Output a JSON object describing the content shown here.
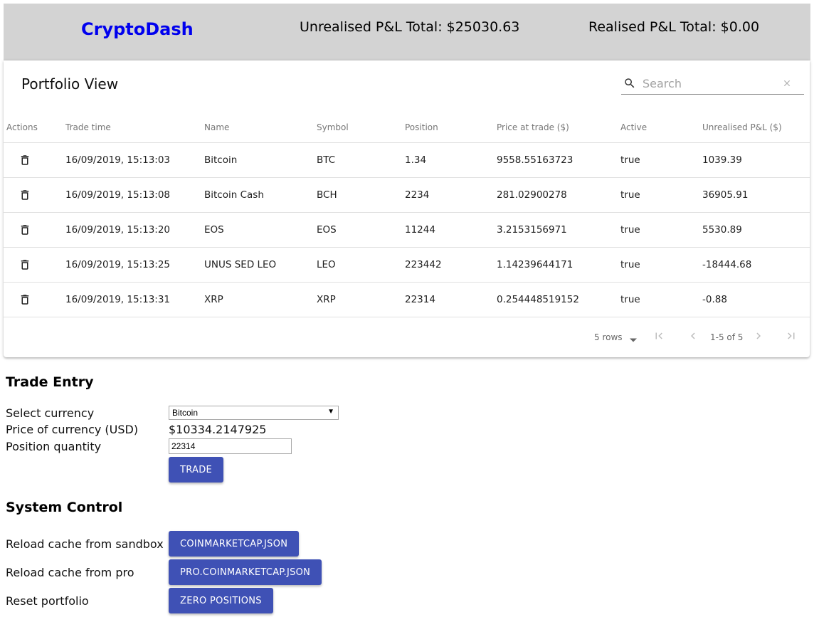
{
  "header": {
    "brand": "CryptoDash",
    "unrealised_total": "Unrealised P&L Total: $25030.63",
    "realised_total": "Realised P&L Total: $0.00"
  },
  "portfolio": {
    "title": "Portfolio View",
    "search_placeholder": "Search",
    "columns": [
      "Actions",
      "Trade time",
      "Name",
      "Symbol",
      "Position",
      "Price at trade ($)",
      "Active",
      "Unrealised P&L ($)"
    ],
    "rows": [
      {
        "time": "16/09/2019, 15:13:03",
        "name": "Bitcoin",
        "symbol": "BTC",
        "position": "1.34",
        "price": "9558.55163723",
        "active": "true",
        "pnl": "1039.39"
      },
      {
        "time": "16/09/2019, 15:13:08",
        "name": "Bitcoin Cash",
        "symbol": "BCH",
        "position": "2234",
        "price": "281.02900278",
        "active": "true",
        "pnl": "36905.91"
      },
      {
        "time": "16/09/2019, 15:13:20",
        "name": "EOS",
        "symbol": "EOS",
        "position": "11244",
        "price": "3.2153156971",
        "active": "true",
        "pnl": "5530.89"
      },
      {
        "time": "16/09/2019, 15:13:25",
        "name": "UNUS SED LEO",
        "symbol": "LEO",
        "position": "223442",
        "price": "1.14239644171",
        "active": "true",
        "pnl": "-18444.68"
      },
      {
        "time": "16/09/2019, 15:13:31",
        "name": "XRP",
        "symbol": "XRP",
        "position": "22314",
        "price": "0.254448519152",
        "active": "true",
        "pnl": "-0.88"
      }
    ],
    "pagination": {
      "rows_per_page": "5 rows",
      "range": "1-5 of 5"
    }
  },
  "trade_entry": {
    "title": "Trade Entry",
    "select_label": "Select currency",
    "selected_currency": "Bitcoin",
    "price_label": "Price of currency (USD)",
    "price_value": "$10334.2147925",
    "qty_label": "Position quantity",
    "qty_value": "22314",
    "trade_button": "TRADE"
  },
  "system_control": {
    "title": "System Control",
    "items": [
      {
        "label": "Reload cache from sandbox",
        "button": "COINMARKETCAP.JSON"
      },
      {
        "label": "Reload cache from pro",
        "button": "PRO.COINMARKETCAP.JSON"
      },
      {
        "label": "Reset portfolio",
        "button": "ZERO POSITIONS"
      }
    ]
  },
  "colors": {
    "header_bg": "#d3d3d3",
    "brand": "#0000ee",
    "button": "#3f51b5"
  }
}
